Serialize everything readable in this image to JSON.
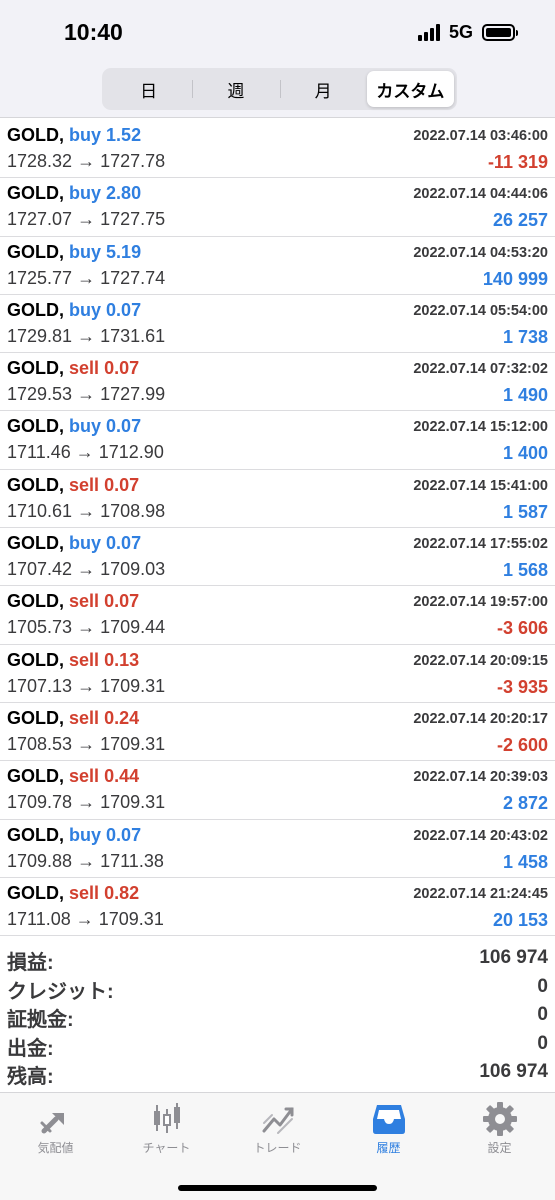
{
  "status": {
    "time": "10:40",
    "network": "5G"
  },
  "segments": [
    {
      "label": "日",
      "active": false
    },
    {
      "label": "週",
      "active": false
    },
    {
      "label": "月",
      "active": false
    },
    {
      "label": "カスタム",
      "active": true
    }
  ],
  "trades": [
    {
      "symbol": "GOLD,",
      "side": "buy",
      "volume": "1.52",
      "open": "1728.32",
      "arrow": "→",
      "close": "1727.78",
      "time": "2022.07.14 03:46:00",
      "profit": "-11 319"
    },
    {
      "symbol": "GOLD,",
      "side": "buy",
      "volume": "2.80",
      "open": "1727.07",
      "arrow": "→",
      "close": "1727.75",
      "time": "2022.07.14 04:44:06",
      "profit": "26 257"
    },
    {
      "symbol": "GOLD,",
      "side": "buy",
      "volume": "5.19",
      "open": "1725.77",
      "arrow": "→",
      "close": "1727.74",
      "time": "2022.07.14 04:53:20",
      "profit": "140 999"
    },
    {
      "symbol": "GOLD,",
      "side": "buy",
      "volume": "0.07",
      "open": "1729.81",
      "arrow": "→",
      "close": "1731.61",
      "time": "2022.07.14 05:54:00",
      "profit": "1 738"
    },
    {
      "symbol": "GOLD,",
      "side": "sell",
      "volume": "0.07",
      "open": "1729.53",
      "arrow": "→",
      "close": "1727.99",
      "time": "2022.07.14 07:32:02",
      "profit": "1 490"
    },
    {
      "symbol": "GOLD,",
      "side": "buy",
      "volume": "0.07",
      "open": "1711.46",
      "arrow": "→",
      "close": "1712.90",
      "time": "2022.07.14 15:12:00",
      "profit": "1 400"
    },
    {
      "symbol": "GOLD,",
      "side": "sell",
      "volume": "0.07",
      "open": "1710.61",
      "arrow": "→",
      "close": "1708.98",
      "time": "2022.07.14 15:41:00",
      "profit": "1 587"
    },
    {
      "symbol": "GOLD,",
      "side": "buy",
      "volume": "0.07",
      "open": "1707.42",
      "arrow": "→",
      "close": "1709.03",
      "time": "2022.07.14 17:55:02",
      "profit": "1 568"
    },
    {
      "symbol": "GOLD,",
      "side": "sell",
      "volume": "0.07",
      "open": "1705.73",
      "arrow": "→",
      "close": "1709.44",
      "time": "2022.07.14 19:57:00",
      "profit": "-3 606"
    },
    {
      "symbol": "GOLD,",
      "side": "sell",
      "volume": "0.13",
      "open": "1707.13",
      "arrow": "→",
      "close": "1709.31",
      "time": "2022.07.14 20:09:15",
      "profit": "-3 935"
    },
    {
      "symbol": "GOLD,",
      "side": "sell",
      "volume": "0.24",
      "open": "1708.53",
      "arrow": "→",
      "close": "1709.31",
      "time": "2022.07.14 20:20:17",
      "profit": "-2 600"
    },
    {
      "symbol": "GOLD,",
      "side": "sell",
      "volume": "0.44",
      "open": "1709.78",
      "arrow": "→",
      "close": "1709.31",
      "time": "2022.07.14 20:39:03",
      "profit": "2 872"
    },
    {
      "symbol": "GOLD,",
      "side": "buy",
      "volume": "0.07",
      "open": "1709.88",
      "arrow": "→",
      "close": "1711.38",
      "time": "2022.07.14 20:43:02",
      "profit": "1 458"
    },
    {
      "symbol": "GOLD,",
      "side": "sell",
      "volume": "0.82",
      "open": "1711.08",
      "arrow": "→",
      "close": "1709.31",
      "time": "2022.07.14 21:24:45",
      "profit": "20 153"
    }
  ],
  "summary": [
    {
      "label": "損益:",
      "value": "106 974"
    },
    {
      "label": "クレジット:",
      "value": "0"
    },
    {
      "label": "証拠金:",
      "value": "0"
    },
    {
      "label": "出金:",
      "value": "0"
    },
    {
      "label": "残高:",
      "value": "106 974"
    }
  ],
  "tabs": [
    {
      "label": "気配値",
      "icon": "quotes-arrows-icon",
      "active": false
    },
    {
      "label": "チャート",
      "icon": "candlestick-chart-icon",
      "active": false
    },
    {
      "label": "トレード",
      "icon": "trade-chart-icon",
      "active": false
    },
    {
      "label": "履歴",
      "icon": "history-inbox-icon",
      "active": true
    },
    {
      "label": "設定",
      "icon": "gear-icon",
      "active": false
    }
  ],
  "colors": {
    "buy": "#2f7fe0",
    "sell": "#d2402f",
    "active_tab": "#2f7fe0",
    "inactive_tab": "#8e8e93"
  }
}
